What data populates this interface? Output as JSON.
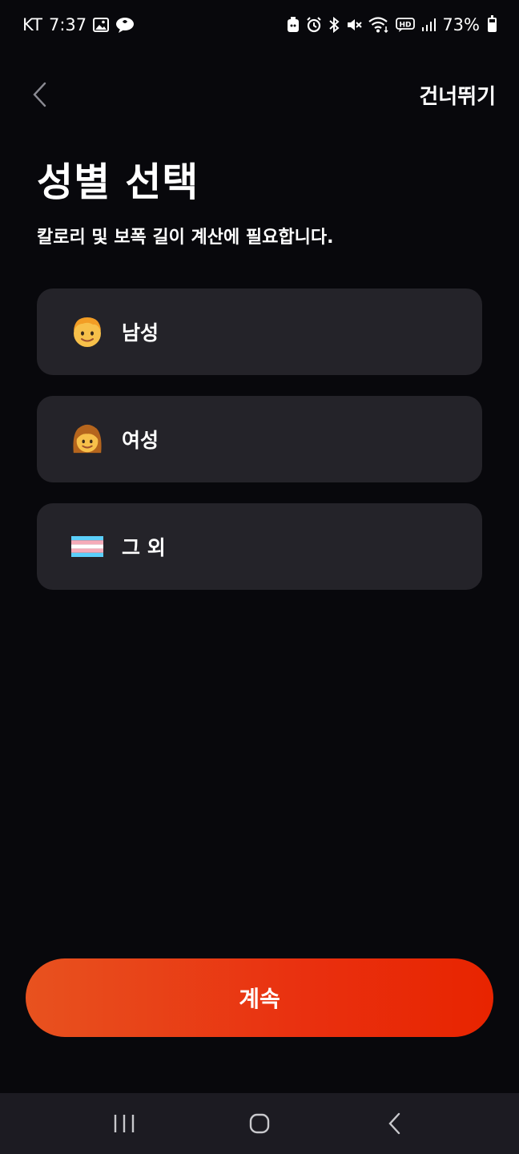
{
  "status_bar": {
    "carrier": "KT",
    "time": "7:37",
    "battery_percent": "73%",
    "battery_level": 0.73,
    "left_icons": [
      "gallery-icon",
      "chat-bubble-icon"
    ],
    "right_icons": [
      "android-box-icon",
      "alarm-icon",
      "bluetooth-icon",
      "mute-icon",
      "wifi-icon",
      "hd-voice-icon",
      "signal-icon",
      "battery-icon"
    ]
  },
  "header": {
    "back_icon": "chevron-left-icon",
    "skip_label": "건너뛰기"
  },
  "page": {
    "title": "성별 선택",
    "subtitle": "칼로리 및 보폭 길이 계산에 필요합니다."
  },
  "options": [
    {
      "label": "남성",
      "icon": "man-emoji-icon"
    },
    {
      "label": "여성",
      "icon": "woman-emoji-icon"
    },
    {
      "label": "그 외",
      "icon": "transgender-flag-icon"
    }
  ],
  "continue": {
    "label": "계속"
  },
  "colors": {
    "background": "#08080c",
    "card": "#242329",
    "accent_start": "#e8521f",
    "accent_end": "#e82400",
    "nav_bar": "#1c1b22"
  },
  "nav_bar": {
    "icons": [
      "recent-apps-icon",
      "home-icon",
      "back-icon"
    ]
  }
}
